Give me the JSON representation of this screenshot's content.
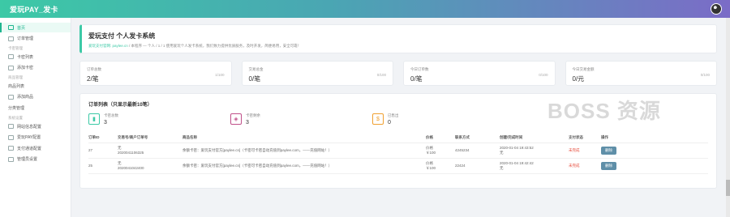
{
  "app": {
    "title": "爱玩PAY_发卡"
  },
  "sidebar": {
    "items": [
      {
        "label": "首页",
        "active": true
      },
      {
        "label": "订单管理"
      }
    ],
    "group1": "卡密管理",
    "items2": [
      {
        "label": "卡密列表"
      },
      {
        "label": "添加卡密"
      }
    ],
    "group2": "商品管理",
    "items3": [
      {
        "label": "商品列表"
      },
      {
        "label": "添加商品"
      },
      {
        "label": "分类管理"
      }
    ],
    "group3": "系统设置",
    "items4": [
      {
        "label": "网站信息配置"
      },
      {
        "label": "爱玩PAY配置"
      },
      {
        "label": "支付通道配置"
      },
      {
        "label": "管理员设置"
      }
    ]
  },
  "banner": {
    "title": "爱玩支付 个人发卡系统",
    "link": "爱玩支付官网: paylee.cn",
    "text": " / 本程序 — 个人 / 1 / 1 使用爱玩个人发卡系统，我们致力提供优质服务，及时开发，简便易用，安全可靠！"
  },
  "stats": [
    {
      "label": "订单总数",
      "value": "2/笔",
      "frac": "1/100"
    },
    {
      "label": "交易总金",
      "value": "0/笔",
      "frac": "0/100"
    },
    {
      "label": "今日订单数",
      "value": "0/笔",
      "frac": "0/100"
    },
    {
      "label": "今日交易金额",
      "value": "0/元",
      "frac": "0/100"
    }
  ],
  "orders": {
    "title": "订单列表（只显示最新10笔）",
    "minis": [
      {
        "label": "卡密总数",
        "value": "3",
        "icon": "bar-chart-icon",
        "color": "#3cc9a6"
      },
      {
        "label": "卡密剩余",
        "value": "3",
        "icon": "tag-icon",
        "color": "#c0508a"
      },
      {
        "label": "已售出",
        "value": "0",
        "icon": "dollar-icon",
        "color": "#f0a030"
      }
    ],
    "headers": [
      "订单ID",
      "交易号/商户订单号",
      "商品名称",
      "价格",
      "联系方式",
      "创建/完成时间",
      "支付状态",
      "操作"
    ],
    "rows": [
      {
        "id": "27",
        "trade": "无\n2020041106325",
        "name": "余额卡密：爱玩支付官方[paylee.cn]（卡密可卡密自动充值到paylee.com，——充值网站！）",
        "price": "价格\n￥100",
        "contact": "4245234",
        "time": "2020-01-04 19:43:52\n无",
        "status": "未完成",
        "action": "删除"
      },
      {
        "id": "25",
        "trade": "无\n2020041042400",
        "name": "余额卡密：爱玩支付官方[paylee.cn]（卡密可卡密自动充值到paylee.com，——充值网站！）",
        "price": "价格\n￥100",
        "contact": "22424",
        "time": "2020-01-04 19:42:42\n无",
        "status": "未完成",
        "action": "删除"
      }
    ]
  },
  "watermark": "BOSS 资源"
}
